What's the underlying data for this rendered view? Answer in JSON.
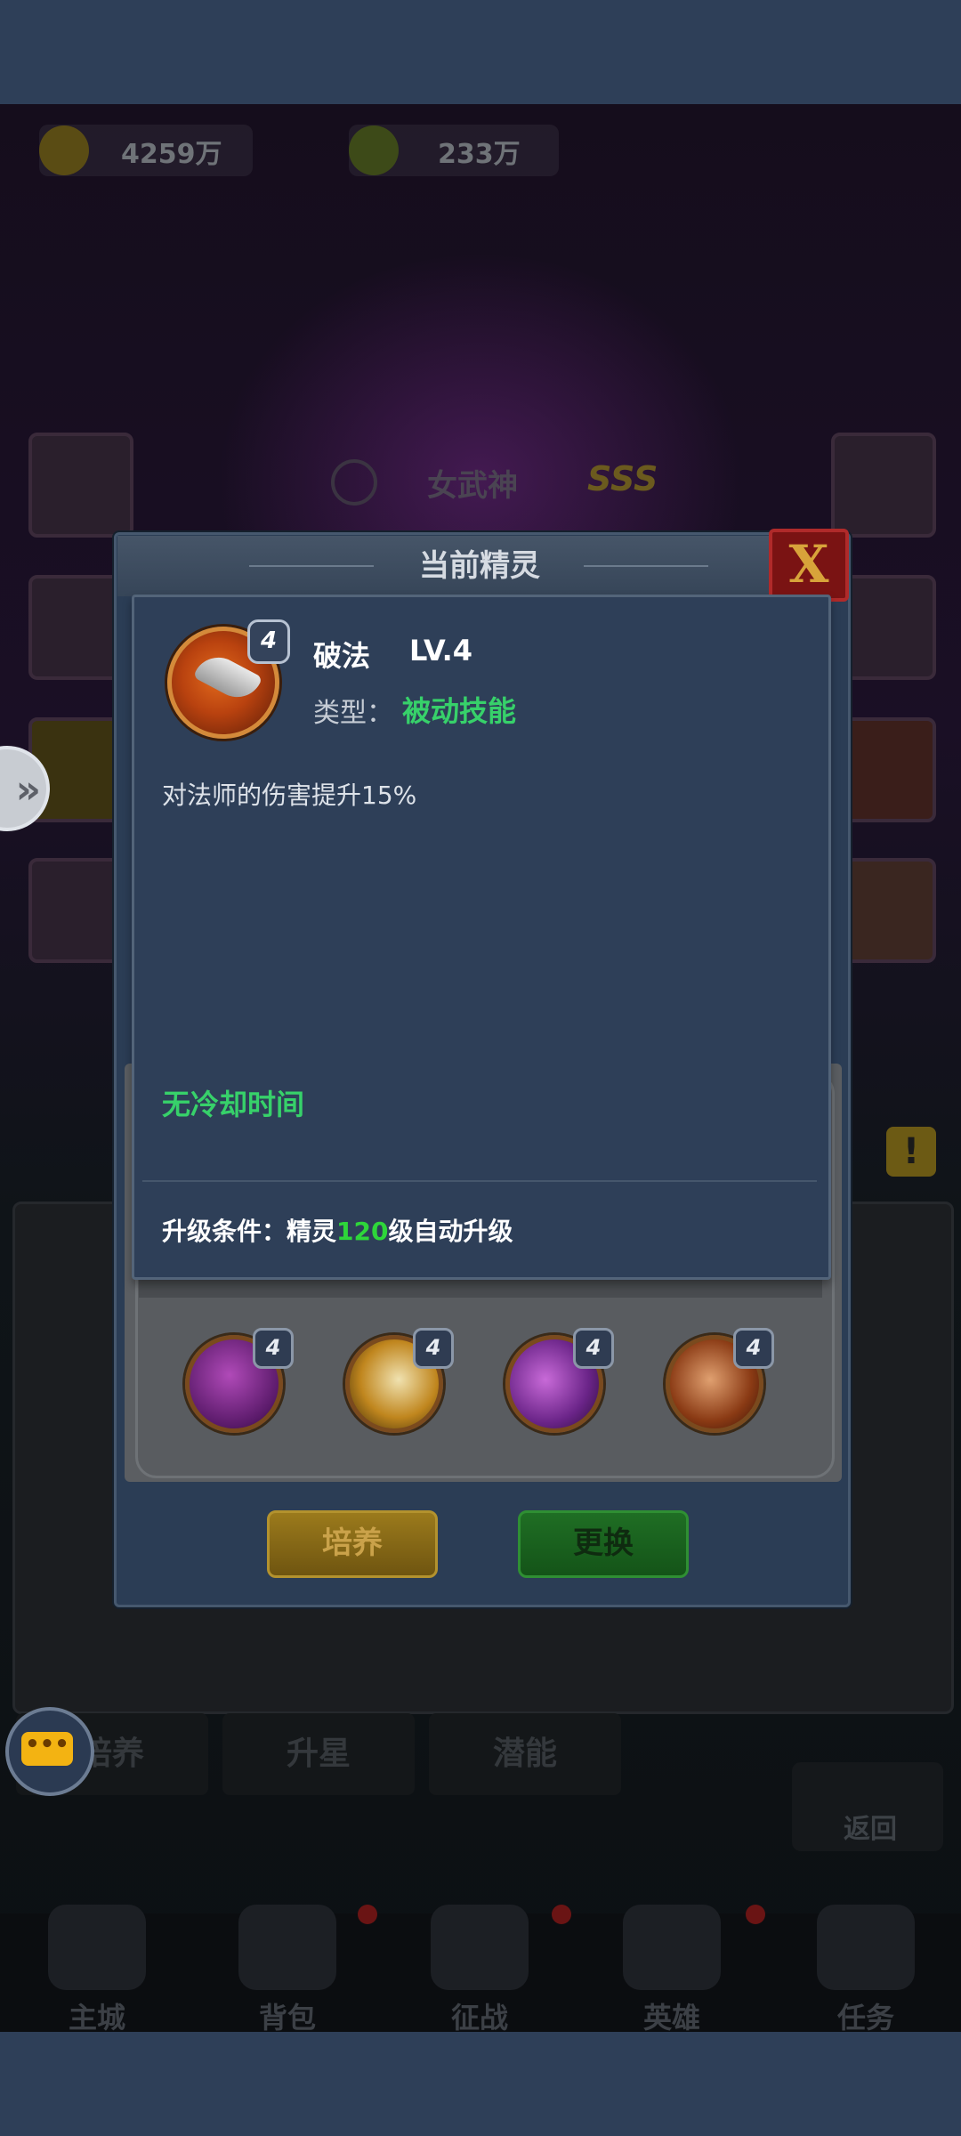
{
  "resources": {
    "gold": "4259万",
    "gems": "233万"
  },
  "hero": {
    "name": "女武神",
    "rank": "SSS"
  },
  "dialog": {
    "title": "当前精灵",
    "close_label": "X"
  },
  "skill": {
    "name": "破法",
    "level": "LV.4",
    "badge_level": "4",
    "type_label": "类型：",
    "type_value": "被动技能",
    "description": "对法师的伤害提升15%",
    "cooldown": "无冷却时间",
    "upgrade_prefix": "升级条件：精灵",
    "upgrade_level": "120",
    "upgrade_suffix": "级自动升级"
  },
  "spirit_orbs": [
    {
      "name": "purple-orb",
      "level": "4"
    },
    {
      "name": "gold-orb",
      "level": "4"
    },
    {
      "name": "violet-orb",
      "level": "4"
    },
    {
      "name": "blade-orb",
      "level": "4"
    }
  ],
  "buttons": {
    "train": "培养",
    "change": "更换"
  },
  "background_tabs": [
    "培养",
    "升星",
    "潜能"
  ],
  "return_label": "返回",
  "bottom_nav": [
    "主城",
    "背包",
    "征战",
    "英雄",
    "任务"
  ],
  "chat_label": "•••",
  "colors": {
    "accent_green": "#37d16a",
    "level_green": "#2ed63a",
    "panel_bg": "#2e3f58"
  }
}
